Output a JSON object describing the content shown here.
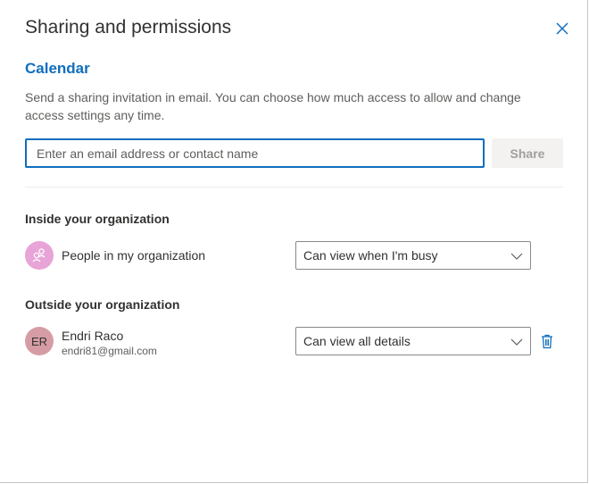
{
  "dialog": {
    "title": "Sharing and permissions",
    "calendar_name": "Calendar",
    "description": "Send a sharing invitation in email. You can choose how much access to allow and change access settings any time.",
    "close_icon": "close-icon"
  },
  "invite": {
    "placeholder": "Enter an email address or contact name",
    "value": "",
    "share_label": "Share"
  },
  "inside": {
    "heading": "Inside your organization",
    "entry": {
      "name": "People in my organization",
      "avatar_icon": "people-group-icon",
      "permission": "Can view when I'm busy"
    }
  },
  "outside": {
    "heading": "Outside your organization",
    "entry": {
      "initials": "ER",
      "name": "Endri Raco",
      "email": "endri81@gmail.com",
      "permission": "Can view all details",
      "delete_icon": "trash-icon"
    }
  },
  "colors": {
    "accent": "#106ebe",
    "org_avatar": "#e8a4d6",
    "user_avatar": "#d69ca5"
  }
}
